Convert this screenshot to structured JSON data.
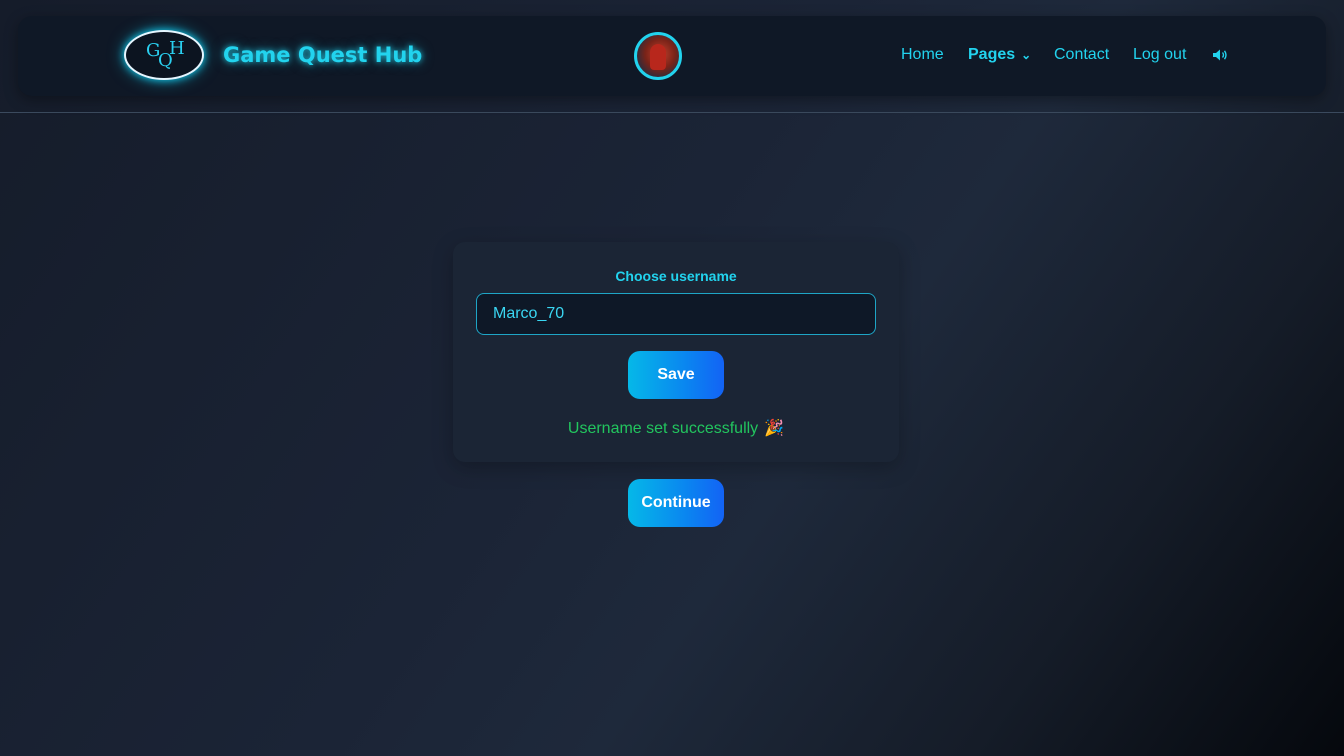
{
  "header": {
    "logo_letters": [
      "G",
      "Q",
      "H"
    ],
    "brand": "Game Quest Hub",
    "nav": {
      "home": "Home",
      "pages": "Pages",
      "contact": "Contact",
      "logout": "Log out"
    },
    "icons": {
      "chevron": "chevron-down-icon",
      "sound": "speaker-icon",
      "avatar": "user-avatar"
    }
  },
  "form": {
    "label": "Choose username",
    "username_value": "Marco_70",
    "save_label": "Save",
    "status": "Username set successfully",
    "status_icon": "🎉"
  },
  "continue_label": "Continue",
  "colors": {
    "accent": "#22d3ee",
    "success": "#22c55e",
    "button_gradient_start": "#05b8e8",
    "button_gradient_end": "#1363f5"
  }
}
